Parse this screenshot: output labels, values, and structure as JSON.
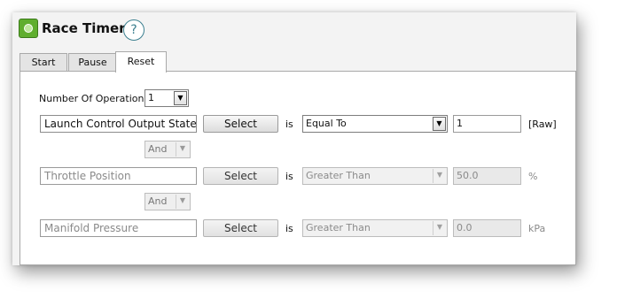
{
  "header": {
    "title": "Race Timer",
    "help_glyph": "?",
    "app_icon": "race-timer-app-icon"
  },
  "tabs": [
    {
      "label": "Start"
    },
    {
      "label": "Pause"
    },
    {
      "label": "Reset",
      "active": true
    }
  ],
  "operations": {
    "label": "Number Of Operations",
    "value": "1"
  },
  "conditions": [
    {
      "channel": "Launch Control Output State",
      "select_label": "Select",
      "is_label": "is",
      "operator": "Equal To",
      "value": "1",
      "unit": "[Raw]",
      "enabled": true
    },
    {
      "channel": "Throttle Position",
      "select_label": "Select",
      "is_label": "is",
      "operator": "Greater Than",
      "value": "50.0",
      "unit": "%",
      "enabled": false
    },
    {
      "channel": "Manifold Pressure",
      "select_label": "Select",
      "is_label": "is",
      "operator": "Greater Than",
      "value": "0.0",
      "unit": "kPa",
      "enabled": false
    }
  ],
  "connectors": [
    {
      "value": "And"
    },
    {
      "value": "And"
    }
  ],
  "colors": {
    "accent_green": "#5fae2e",
    "help_teal": "#3b7f8f",
    "disabled_text": "#8a8a8a"
  }
}
